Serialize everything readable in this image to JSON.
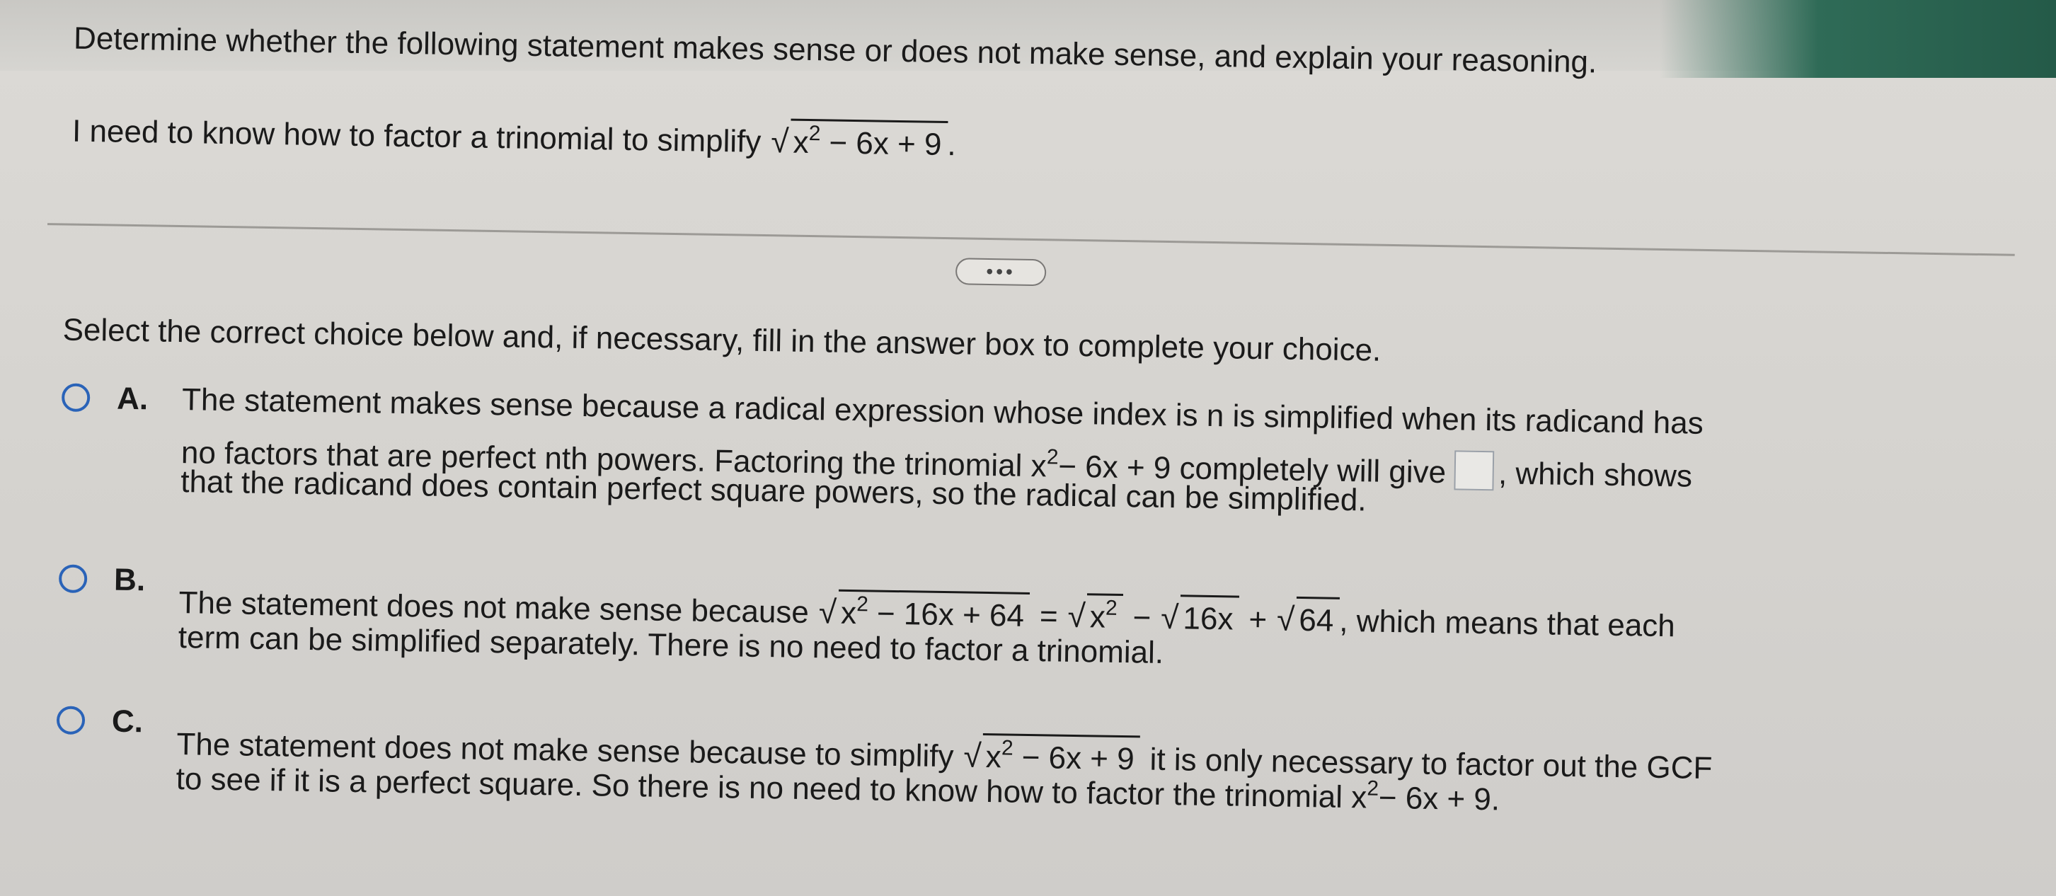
{
  "question": {
    "title": "Determine whether the following statement makes sense or does not make sense, and explain your reasoning.",
    "statement_text": "I need to know how to factor a trinomial to simplify",
    "statement_radicand_base": "x",
    "statement_radicand_exp": "2",
    "statement_radicand_rest": " − 6x + 9",
    "statement_end": "."
  },
  "more_button": {
    "label": "•••"
  },
  "instruction": "Select the correct choice below and, if necessary, fill in the answer box to complete your choice.",
  "choices": [
    {
      "letter": "A.",
      "line1": "The statement makes sense because a radical expression whose index is n is simplified when its radicand has",
      "line2_a": "no factors that are perfect nth powers. Factoring the trinomial x",
      "line2_exp": "2",
      "line2_b": " − 6x + 9 completely will give",
      "line2_c": ", which shows",
      "line3": "that the radicand does contain perfect square powers, so the radical can be simplified."
    },
    {
      "letter": "B.",
      "line1_a": "The statement does not make sense because",
      "rad1_base": "x",
      "rad1_exp": "2",
      "rad1_rest": " − 16x + 64",
      "eq": "=",
      "rad2_base": "x",
      "rad2_exp": "2",
      "minus": "−",
      "rad3": "16x",
      "plus": "+",
      "rad4": "64",
      "line1_b": ", which means that each",
      "line2": "term can be simplified separately. There is no need to factor a trinomial."
    },
    {
      "letter": "C.",
      "line1_a": "The statement does not make sense because to simplify",
      "rad_base": "x",
      "rad_exp": "2",
      "rad_rest": " − 6x + 9",
      "line1_b": "it is only necessary to factor out the GCF",
      "line2_a": "to see if it is a perfect square. So there is no need to know how to factor the trinomial x",
      "line2_exp": "2",
      "line2_b": " − 6x + 9."
    }
  ],
  "colors": {
    "radio_border": "#2a63b8",
    "top_accent": "#2f6b57"
  }
}
